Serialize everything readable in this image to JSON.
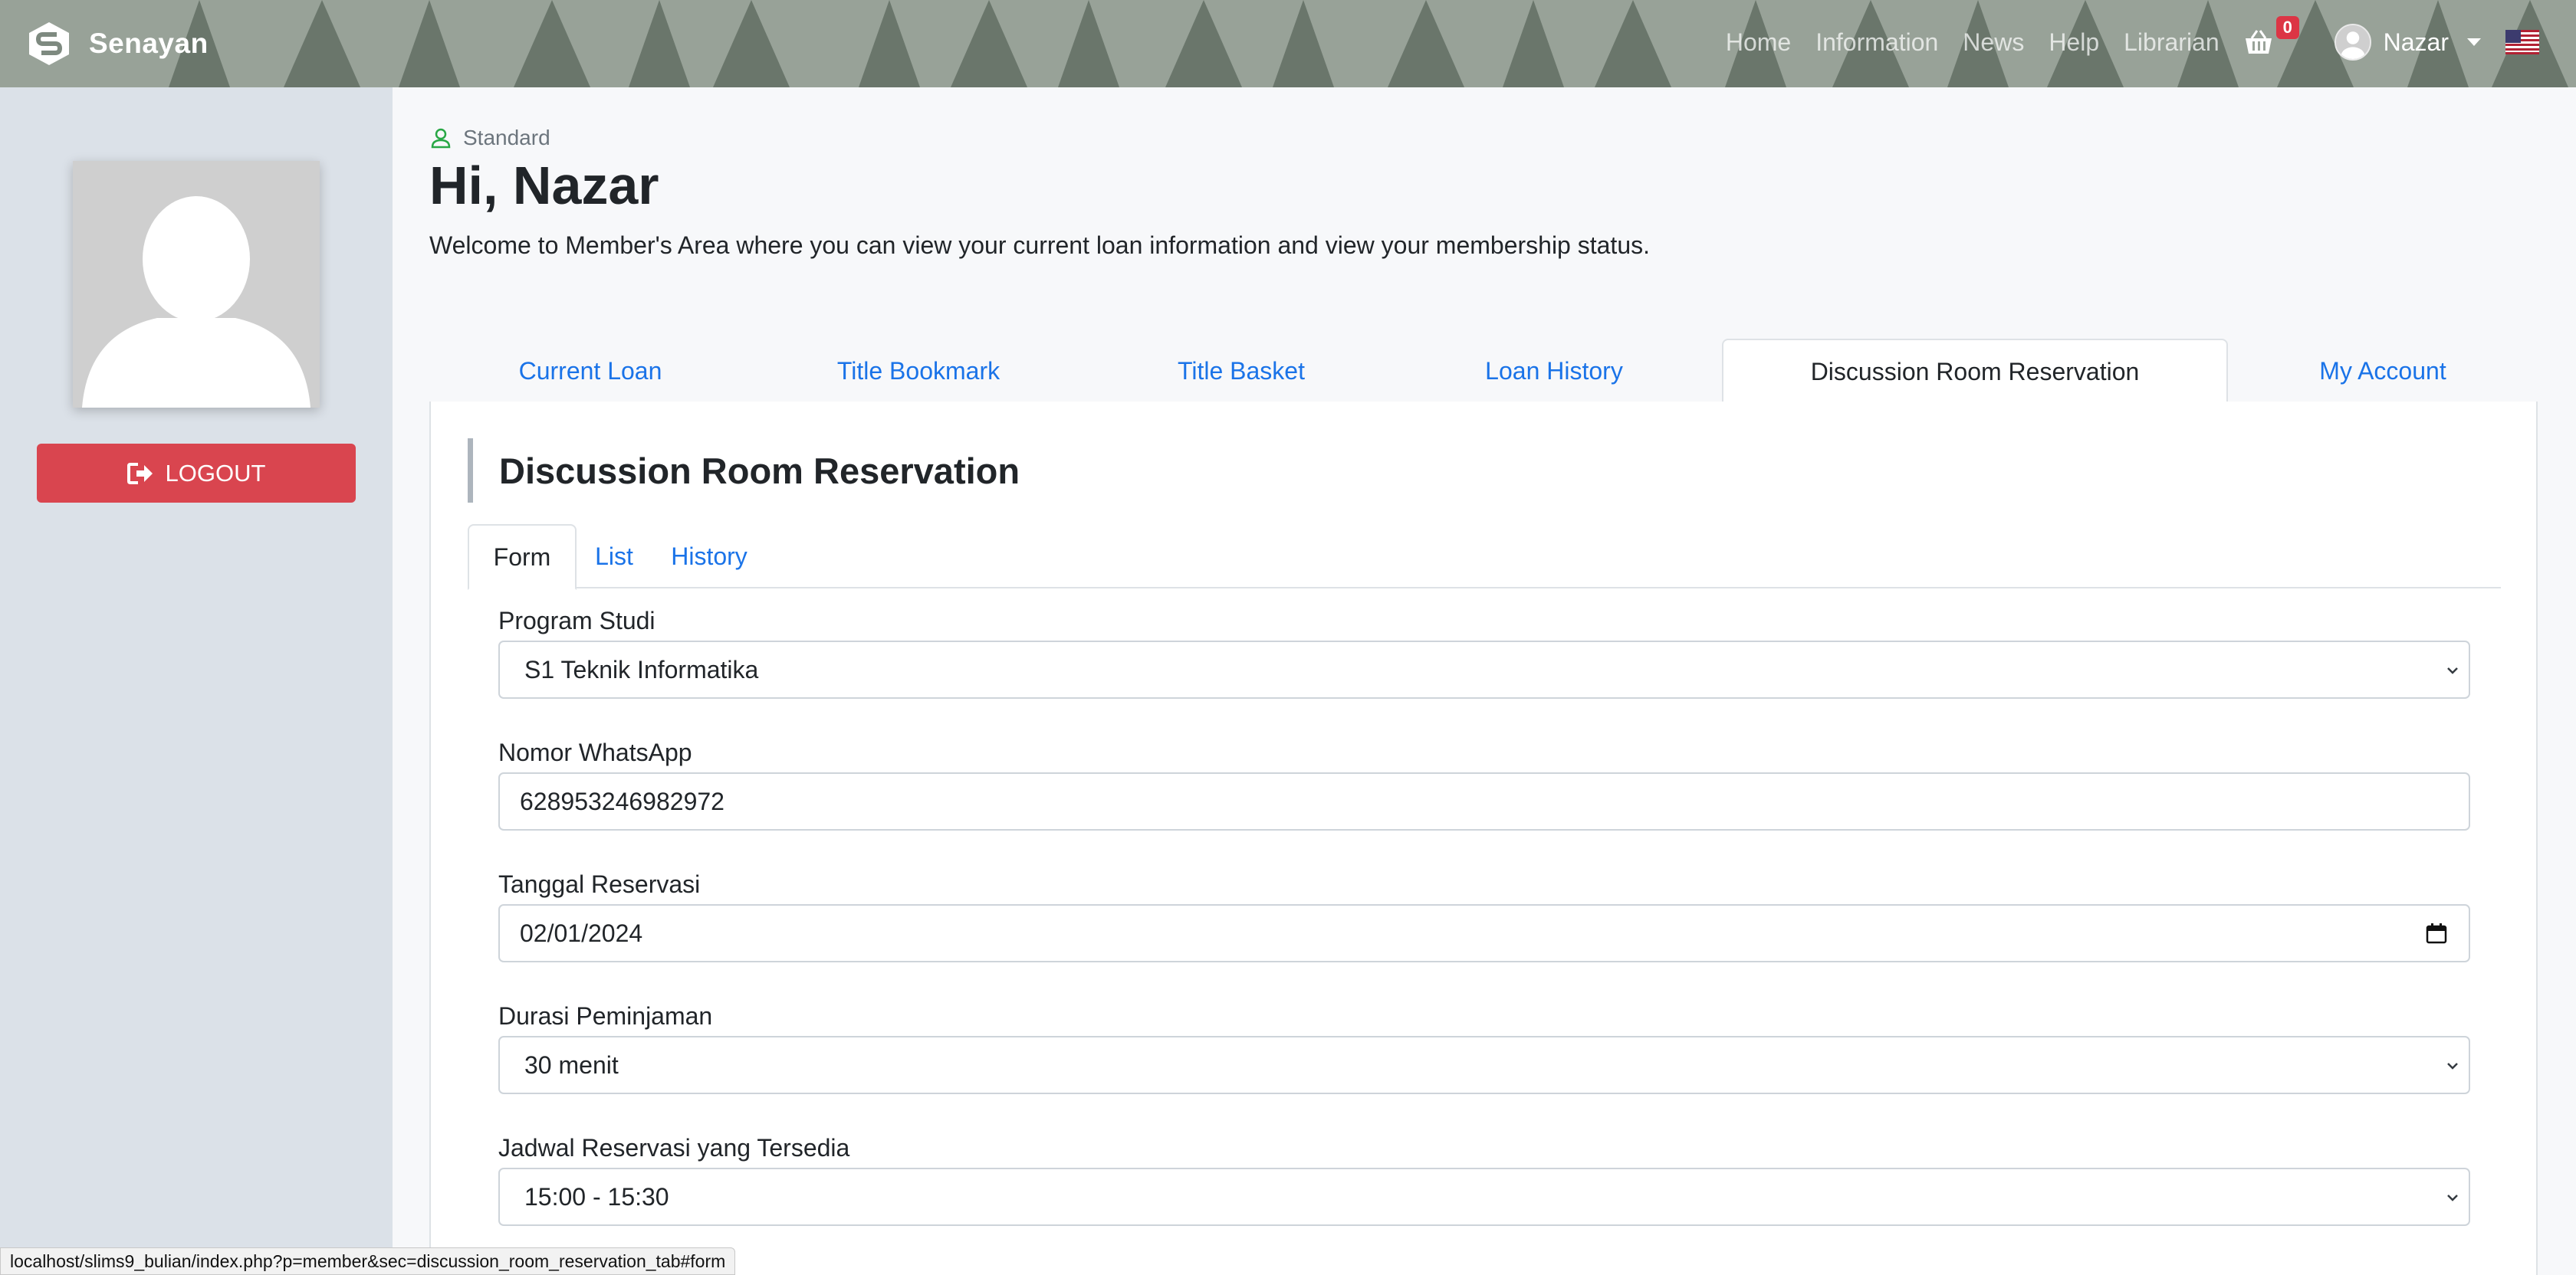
{
  "navbar": {
    "brand": "Senayan",
    "links": [
      "Home",
      "Information",
      "News",
      "Help",
      "Librarian"
    ],
    "basket_count": "0",
    "user_name": "Nazar",
    "icons": {
      "basket": "basket-icon",
      "flag": "us-flag-icon",
      "logo": "senayan-logo-icon"
    }
  },
  "sidebar": {
    "logout_label": "LOGOUT",
    "colors": {
      "logout": "#d9454f"
    }
  },
  "main": {
    "membership_type": "Standard",
    "greeting": "Hi, Nazar",
    "welcome": "Welcome to Member's Area where you can view your current loan information and view your membership status.",
    "tabs": [
      {
        "label": "Current Loan",
        "active": false
      },
      {
        "label": "Title Bookmark",
        "active": false
      },
      {
        "label": "Title Basket",
        "active": false
      },
      {
        "label": "Loan History",
        "active": false
      },
      {
        "label": "Discussion Room Reservation",
        "active": true
      },
      {
        "label": "My Account",
        "active": false
      }
    ]
  },
  "reservation": {
    "title": "Discussion Room Reservation",
    "subtabs": [
      {
        "label": "Form",
        "active": true
      },
      {
        "label": "List",
        "active": false
      },
      {
        "label": "History",
        "active": false
      }
    ],
    "fields": {
      "program_studi": {
        "label": "Program Studi",
        "value": "S1 Teknik Informatika"
      },
      "whatsapp": {
        "label": "Nomor WhatsApp",
        "value": "628953246982972"
      },
      "tanggal": {
        "label": "Tanggal Reservasi",
        "value": "02/01/2024"
      },
      "durasi": {
        "label": "Durasi Peminjaman",
        "value": "30 menit"
      },
      "jadwal": {
        "label": "Jadwal Reservasi yang Tersedia",
        "value": "15:00 - 15:30"
      }
    }
  },
  "statusbar": {
    "url": "localhost/slims9_bulian/index.php?p=member&sec=discussion_room_reservation_tab#form"
  },
  "colors": {
    "link": "#1a73e8",
    "danger": "#dc3545"
  }
}
